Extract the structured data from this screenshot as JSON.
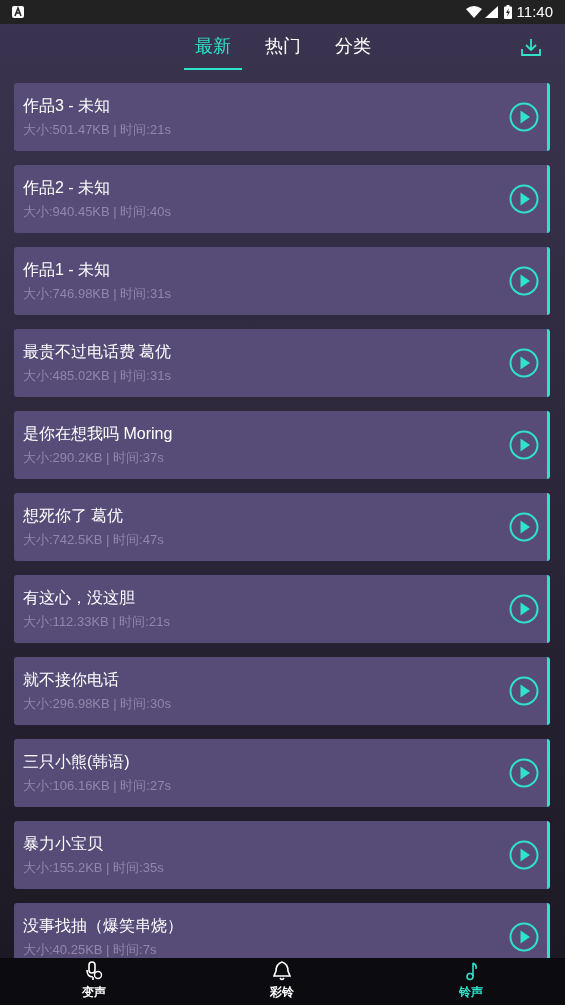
{
  "status_bar": {
    "time": "11:40"
  },
  "tabs": [
    {
      "label": "最新",
      "selected": true
    },
    {
      "label": "热门",
      "selected": false
    },
    {
      "label": "分类",
      "selected": false
    }
  ],
  "songs": [
    {
      "title": "作品3 - 未知",
      "info": "大小:501.47KB | 时间:21s"
    },
    {
      "title": "作品2 - 未知",
      "info": "大小:940.45KB | 时间:40s"
    },
    {
      "title": "作品1 - 未知",
      "info": "大小:746.98KB | 时间:31s"
    },
    {
      "title": "最贵不过电话费 葛优",
      "info": "大小:485.02KB | 时间:31s"
    },
    {
      "title": "是你在想我吗 Moring",
      "info": "大小:290.2KB | 时间:37s"
    },
    {
      "title": "想死你了 葛优",
      "info": "大小:742.5KB | 时间:47s"
    },
    {
      "title": "有这心，没这胆",
      "info": "大小:112.33KB | 时间:21s"
    },
    {
      "title": "就不接你电话",
      "info": "大小:296.98KB | 时间:30s"
    },
    {
      "title": "三只小熊(韩语)",
      "info": "大小:106.16KB | 时间:27s"
    },
    {
      "title": "暴力小宝贝",
      "info": "大小:155.2KB | 时间:35s"
    },
    {
      "title": "没事找抽（爆笑串烧）",
      "info": "大小:40.25KB | 时间:7s"
    }
  ],
  "bottom_nav": [
    {
      "kind": "voice",
      "label": "变声",
      "selected": false
    },
    {
      "kind": "bell",
      "label": "彩铃",
      "selected": false
    },
    {
      "kind": "note",
      "label": "铃声",
      "selected": true
    }
  ]
}
